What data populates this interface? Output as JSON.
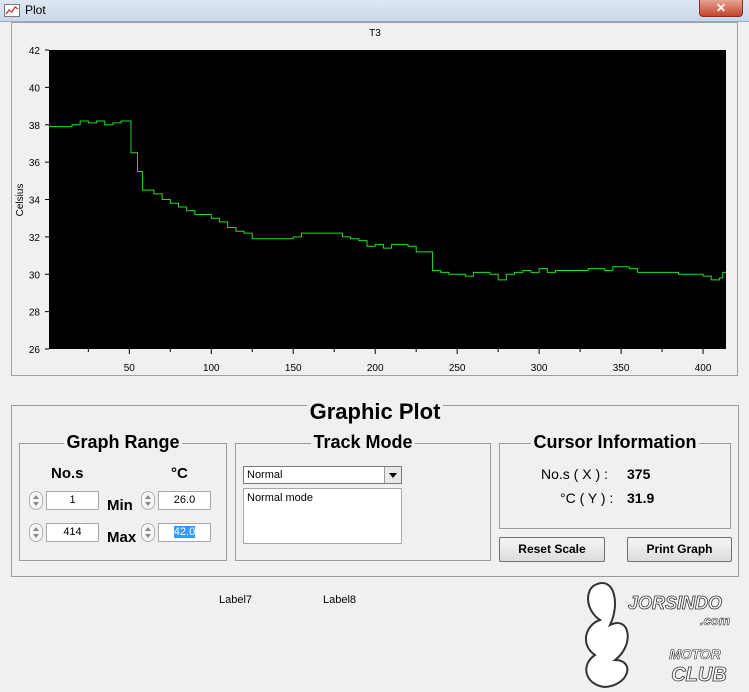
{
  "window": {
    "title": "Plot",
    "close_label": "✕"
  },
  "chart_data": {
    "type": "line",
    "title": "T3",
    "xlabel": "",
    "ylabel": "Celsius",
    "xlim": [
      1,
      414
    ],
    "ylim": [
      26,
      42
    ],
    "x_ticks": [
      50,
      100,
      150,
      200,
      250,
      300,
      350,
      400
    ],
    "y_ticks": [
      26,
      28,
      30,
      32,
      34,
      36,
      38,
      40,
      42
    ],
    "background": "#000000",
    "line_color": "#22dd22",
    "grid": false,
    "series": [
      {
        "points": [
          [
            1,
            37.9
          ],
          [
            10,
            37.9
          ],
          [
            15,
            38.0
          ],
          [
            20,
            38.2
          ],
          [
            25,
            38.1
          ],
          [
            30,
            38.2
          ],
          [
            35,
            38.0
          ],
          [
            40,
            38.1
          ],
          [
            45,
            38.2
          ],
          [
            50,
            38.2
          ],
          [
            51,
            36.5
          ],
          [
            55,
            35.5
          ],
          [
            58,
            34.5
          ],
          [
            65,
            34.3
          ],
          [
            70,
            34.0
          ],
          [
            75,
            33.8
          ],
          [
            80,
            33.6
          ],
          [
            85,
            33.4
          ],
          [
            90,
            33.2
          ],
          [
            95,
            33.2
          ],
          [
            100,
            33.0
          ],
          [
            105,
            32.8
          ],
          [
            110,
            32.5
          ],
          [
            115,
            32.3
          ],
          [
            120,
            32.2
          ],
          [
            125,
            31.9
          ],
          [
            130,
            31.9
          ],
          [
            140,
            31.9
          ],
          [
            150,
            32.0
          ],
          [
            155,
            32.2
          ],
          [
            175,
            32.2
          ],
          [
            180,
            32.0
          ],
          [
            185,
            31.9
          ],
          [
            190,
            31.8
          ],
          [
            195,
            31.5
          ],
          [
            200,
            31.6
          ],
          [
            205,
            31.4
          ],
          [
            210,
            31.6
          ],
          [
            220,
            31.5
          ],
          [
            225,
            31.2
          ],
          [
            233,
            31.2
          ],
          [
            235,
            30.2
          ],
          [
            240,
            30.1
          ],
          [
            245,
            30.0
          ],
          [
            250,
            30.0
          ],
          [
            255,
            29.9
          ],
          [
            260,
            30.1
          ],
          [
            270,
            30.0
          ],
          [
            275,
            29.7
          ],
          [
            280,
            30.0
          ],
          [
            285,
            30.1
          ],
          [
            290,
            30.2
          ],
          [
            295,
            30.1
          ],
          [
            300,
            30.3
          ],
          [
            305,
            30.1
          ],
          [
            310,
            30.2
          ],
          [
            330,
            30.3
          ],
          [
            340,
            30.2
          ],
          [
            345,
            30.4
          ],
          [
            355,
            30.3
          ],
          [
            360,
            30.1
          ],
          [
            380,
            30.1
          ],
          [
            385,
            30.0
          ],
          [
            400,
            29.9
          ],
          [
            405,
            29.7
          ],
          [
            410,
            29.8
          ],
          [
            412,
            30.1
          ],
          [
            414,
            30.1
          ]
        ]
      }
    ]
  },
  "graphic_plot": {
    "title": "Graphic Plot",
    "graph_range": {
      "title": "Graph Range",
      "x_header": "No.s",
      "y_header": "°C",
      "min_label": "Min",
      "max_label": "Max",
      "x_min": "1",
      "x_max": "414",
      "y_min": "26.0",
      "y_max": "42.0"
    },
    "track_mode": {
      "title": "Track Mode",
      "selected": "Normal",
      "description": "Normal mode"
    },
    "cursor_info": {
      "title": "Cursor Information",
      "x_label": "No.s ( X ) :",
      "x_value": "375",
      "y_label": "°C ( Y ) :",
      "y_value": "31.9"
    },
    "reset_scale_label": "Reset Scale",
    "print_graph_label": "Print Graph"
  },
  "labels": {
    "label7": "Label7",
    "label8": "Label8"
  },
  "watermark": {
    "brand": "JORSINDO",
    "domain": ".com",
    "line1": "MOTOR",
    "line2": "CLUB"
  }
}
